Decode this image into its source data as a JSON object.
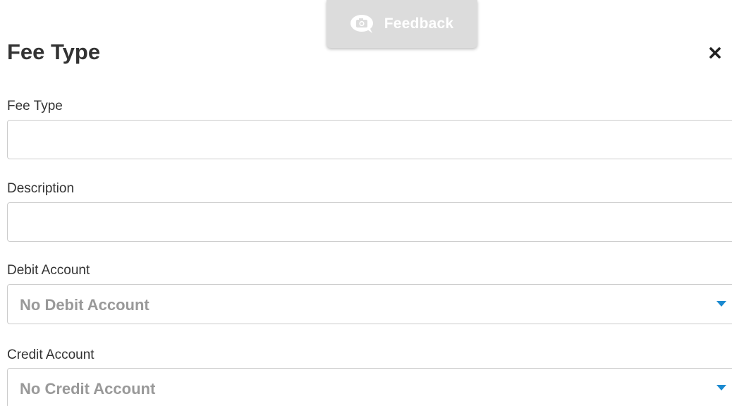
{
  "feedback": {
    "label": "Feedback",
    "icon": "camera-chat-icon",
    "bg_color": "#dcdcdc"
  },
  "dialog": {
    "title": "Fee Type",
    "close_icon": "close-icon"
  },
  "form": {
    "fee_type": {
      "label": "Fee Type",
      "value": "",
      "placeholder": ""
    },
    "description": {
      "label": "Description",
      "value": "",
      "placeholder": ""
    },
    "debit_account": {
      "label": "Debit Account",
      "selected": "No Debit Account"
    },
    "credit_account": {
      "label": "Credit Account",
      "selected": "No Credit Account"
    }
  },
  "colors": {
    "accent": "#1b8ad0",
    "text": "#333333",
    "placeholder_text": "#999999",
    "border": "#cccccc"
  }
}
